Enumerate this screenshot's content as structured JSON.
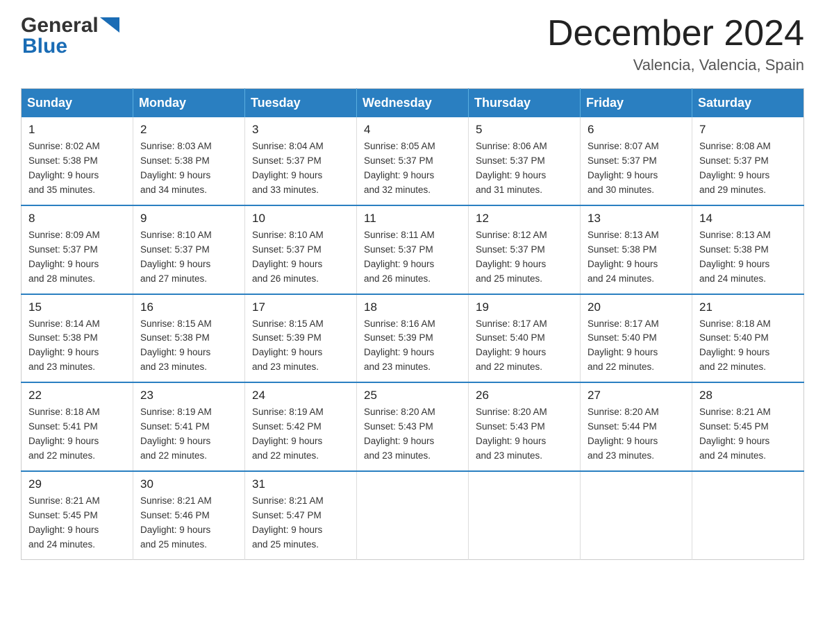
{
  "header": {
    "logo_general": "General",
    "logo_blue": "Blue",
    "month_title": "December 2024",
    "location": "Valencia, Valencia, Spain"
  },
  "days_of_week": [
    "Sunday",
    "Monday",
    "Tuesday",
    "Wednesday",
    "Thursday",
    "Friday",
    "Saturday"
  ],
  "weeks": [
    [
      {
        "day": "1",
        "sunrise": "Sunrise: 8:02 AM",
        "sunset": "Sunset: 5:38 PM",
        "daylight": "Daylight: 9 hours",
        "daylight2": "and 35 minutes."
      },
      {
        "day": "2",
        "sunrise": "Sunrise: 8:03 AM",
        "sunset": "Sunset: 5:38 PM",
        "daylight": "Daylight: 9 hours",
        "daylight2": "and 34 minutes."
      },
      {
        "day": "3",
        "sunrise": "Sunrise: 8:04 AM",
        "sunset": "Sunset: 5:37 PM",
        "daylight": "Daylight: 9 hours",
        "daylight2": "and 33 minutes."
      },
      {
        "day": "4",
        "sunrise": "Sunrise: 8:05 AM",
        "sunset": "Sunset: 5:37 PM",
        "daylight": "Daylight: 9 hours",
        "daylight2": "and 32 minutes."
      },
      {
        "day": "5",
        "sunrise": "Sunrise: 8:06 AM",
        "sunset": "Sunset: 5:37 PM",
        "daylight": "Daylight: 9 hours",
        "daylight2": "and 31 minutes."
      },
      {
        "day": "6",
        "sunrise": "Sunrise: 8:07 AM",
        "sunset": "Sunset: 5:37 PM",
        "daylight": "Daylight: 9 hours",
        "daylight2": "and 30 minutes."
      },
      {
        "day": "7",
        "sunrise": "Sunrise: 8:08 AM",
        "sunset": "Sunset: 5:37 PM",
        "daylight": "Daylight: 9 hours",
        "daylight2": "and 29 minutes."
      }
    ],
    [
      {
        "day": "8",
        "sunrise": "Sunrise: 8:09 AM",
        "sunset": "Sunset: 5:37 PM",
        "daylight": "Daylight: 9 hours",
        "daylight2": "and 28 minutes."
      },
      {
        "day": "9",
        "sunrise": "Sunrise: 8:10 AM",
        "sunset": "Sunset: 5:37 PM",
        "daylight": "Daylight: 9 hours",
        "daylight2": "and 27 minutes."
      },
      {
        "day": "10",
        "sunrise": "Sunrise: 8:10 AM",
        "sunset": "Sunset: 5:37 PM",
        "daylight": "Daylight: 9 hours",
        "daylight2": "and 26 minutes."
      },
      {
        "day": "11",
        "sunrise": "Sunrise: 8:11 AM",
        "sunset": "Sunset: 5:37 PM",
        "daylight": "Daylight: 9 hours",
        "daylight2": "and 26 minutes."
      },
      {
        "day": "12",
        "sunrise": "Sunrise: 8:12 AM",
        "sunset": "Sunset: 5:37 PM",
        "daylight": "Daylight: 9 hours",
        "daylight2": "and 25 minutes."
      },
      {
        "day": "13",
        "sunrise": "Sunrise: 8:13 AM",
        "sunset": "Sunset: 5:38 PM",
        "daylight": "Daylight: 9 hours",
        "daylight2": "and 24 minutes."
      },
      {
        "day": "14",
        "sunrise": "Sunrise: 8:13 AM",
        "sunset": "Sunset: 5:38 PM",
        "daylight": "Daylight: 9 hours",
        "daylight2": "and 24 minutes."
      }
    ],
    [
      {
        "day": "15",
        "sunrise": "Sunrise: 8:14 AM",
        "sunset": "Sunset: 5:38 PM",
        "daylight": "Daylight: 9 hours",
        "daylight2": "and 23 minutes."
      },
      {
        "day": "16",
        "sunrise": "Sunrise: 8:15 AM",
        "sunset": "Sunset: 5:38 PM",
        "daylight": "Daylight: 9 hours",
        "daylight2": "and 23 minutes."
      },
      {
        "day": "17",
        "sunrise": "Sunrise: 8:15 AM",
        "sunset": "Sunset: 5:39 PM",
        "daylight": "Daylight: 9 hours",
        "daylight2": "and 23 minutes."
      },
      {
        "day": "18",
        "sunrise": "Sunrise: 8:16 AM",
        "sunset": "Sunset: 5:39 PM",
        "daylight": "Daylight: 9 hours",
        "daylight2": "and 23 minutes."
      },
      {
        "day": "19",
        "sunrise": "Sunrise: 8:17 AM",
        "sunset": "Sunset: 5:40 PM",
        "daylight": "Daylight: 9 hours",
        "daylight2": "and 22 minutes."
      },
      {
        "day": "20",
        "sunrise": "Sunrise: 8:17 AM",
        "sunset": "Sunset: 5:40 PM",
        "daylight": "Daylight: 9 hours",
        "daylight2": "and 22 minutes."
      },
      {
        "day": "21",
        "sunrise": "Sunrise: 8:18 AM",
        "sunset": "Sunset: 5:40 PM",
        "daylight": "Daylight: 9 hours",
        "daylight2": "and 22 minutes."
      }
    ],
    [
      {
        "day": "22",
        "sunrise": "Sunrise: 8:18 AM",
        "sunset": "Sunset: 5:41 PM",
        "daylight": "Daylight: 9 hours",
        "daylight2": "and 22 minutes."
      },
      {
        "day": "23",
        "sunrise": "Sunrise: 8:19 AM",
        "sunset": "Sunset: 5:41 PM",
        "daylight": "Daylight: 9 hours",
        "daylight2": "and 22 minutes."
      },
      {
        "day": "24",
        "sunrise": "Sunrise: 8:19 AM",
        "sunset": "Sunset: 5:42 PM",
        "daylight": "Daylight: 9 hours",
        "daylight2": "and 22 minutes."
      },
      {
        "day": "25",
        "sunrise": "Sunrise: 8:20 AM",
        "sunset": "Sunset: 5:43 PM",
        "daylight": "Daylight: 9 hours",
        "daylight2": "and 23 minutes."
      },
      {
        "day": "26",
        "sunrise": "Sunrise: 8:20 AM",
        "sunset": "Sunset: 5:43 PM",
        "daylight": "Daylight: 9 hours",
        "daylight2": "and 23 minutes."
      },
      {
        "day": "27",
        "sunrise": "Sunrise: 8:20 AM",
        "sunset": "Sunset: 5:44 PM",
        "daylight": "Daylight: 9 hours",
        "daylight2": "and 23 minutes."
      },
      {
        "day": "28",
        "sunrise": "Sunrise: 8:21 AM",
        "sunset": "Sunset: 5:45 PM",
        "daylight": "Daylight: 9 hours",
        "daylight2": "and 24 minutes."
      }
    ],
    [
      {
        "day": "29",
        "sunrise": "Sunrise: 8:21 AM",
        "sunset": "Sunset: 5:45 PM",
        "daylight": "Daylight: 9 hours",
        "daylight2": "and 24 minutes."
      },
      {
        "day": "30",
        "sunrise": "Sunrise: 8:21 AM",
        "sunset": "Sunset: 5:46 PM",
        "daylight": "Daylight: 9 hours",
        "daylight2": "and 25 minutes."
      },
      {
        "day": "31",
        "sunrise": "Sunrise: 8:21 AM",
        "sunset": "Sunset: 5:47 PM",
        "daylight": "Daylight: 9 hours",
        "daylight2": "and 25 minutes."
      },
      {
        "day": "",
        "sunrise": "",
        "sunset": "",
        "daylight": "",
        "daylight2": ""
      },
      {
        "day": "",
        "sunrise": "",
        "sunset": "",
        "daylight": "",
        "daylight2": ""
      },
      {
        "day": "",
        "sunrise": "",
        "sunset": "",
        "daylight": "",
        "daylight2": ""
      },
      {
        "day": "",
        "sunrise": "",
        "sunset": "",
        "daylight": "",
        "daylight2": ""
      }
    ]
  ]
}
